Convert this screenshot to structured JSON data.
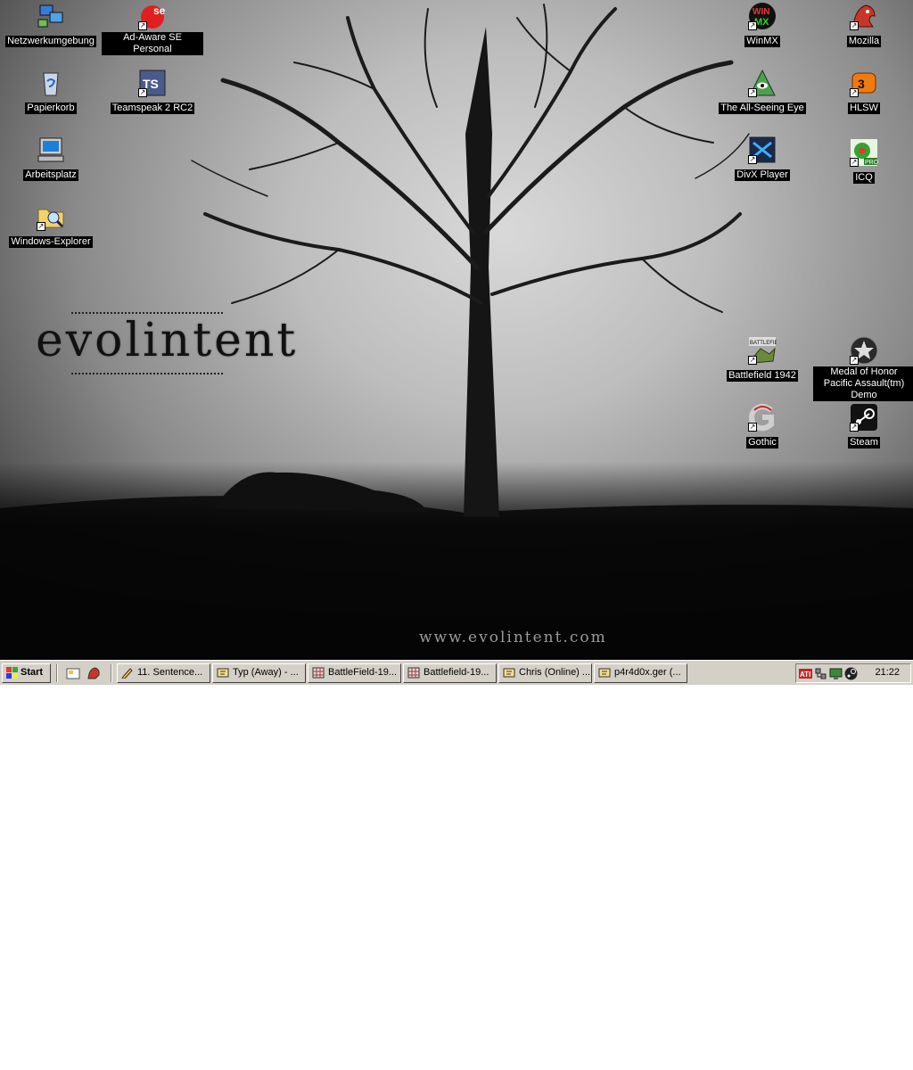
{
  "desktop": {
    "icons_left": [
      {
        "label": "Netzwerkumgebung",
        "icon": "network-icon"
      },
      {
        "label": "Ad-Aware SE Personal",
        "icon": "adaware-icon"
      },
      {
        "label": "Papierkorb",
        "icon": "recycle-bin-icon"
      },
      {
        "label": "Teamspeak 2 RC2",
        "icon": "teamspeak-icon"
      },
      {
        "label": "Arbeitsplatz",
        "icon": "computer-icon"
      },
      {
        "label": "Windows-Explorer",
        "icon": "explorer-icon"
      }
    ],
    "icons_right": [
      {
        "label": "WinMX",
        "icon": "winmx-icon"
      },
      {
        "label": "Mozilla",
        "icon": "mozilla-icon"
      },
      {
        "label": "The All-Seeing Eye",
        "icon": "all-seeing-eye-icon"
      },
      {
        "label": "HLSW",
        "icon": "hlsw-icon"
      },
      {
        "label": "DivX Player",
        "icon": "divx-icon"
      },
      {
        "label": "ICQ",
        "icon": "icq-icon"
      },
      {
        "label": "Battlefield 1942",
        "icon": "battlefield-icon"
      },
      {
        "label": "Medal of Honor Pacific Assault(tm) Demo",
        "icon": "medal-of-honor-icon"
      },
      {
        "label": "Gothic",
        "icon": "gothic-icon"
      },
      {
        "label": "Steam",
        "icon": "steam-icon"
      }
    ],
    "wallpaper": {
      "logo_text": "evolintent",
      "website": "www.evolintent.com"
    }
  },
  "taskbar": {
    "start_label": "Start",
    "buttons": [
      {
        "label": "11. Sentence...",
        "icon": "pencil-icon"
      },
      {
        "label": "Typ (Away) - ...",
        "icon": "chat-icon"
      },
      {
        "label": "BattleField-19...",
        "icon": "app-grid-icon"
      },
      {
        "label": "Battlefield-19...",
        "icon": "app-grid-icon"
      },
      {
        "label": "Chris (Online) ...",
        "icon": "chat-icon"
      },
      {
        "label": "p4r4d0x.ger (...",
        "icon": "chat-icon"
      }
    ],
    "tray_icons": [
      "ati-icon",
      "network-tray-icon",
      "display-tray-icon",
      "steam-tray-icon"
    ],
    "clock": "21:22"
  },
  "colors": {
    "taskbar_bg": "#d4d0c8",
    "label_bg": "#000000",
    "label_text": "#ffffff"
  }
}
